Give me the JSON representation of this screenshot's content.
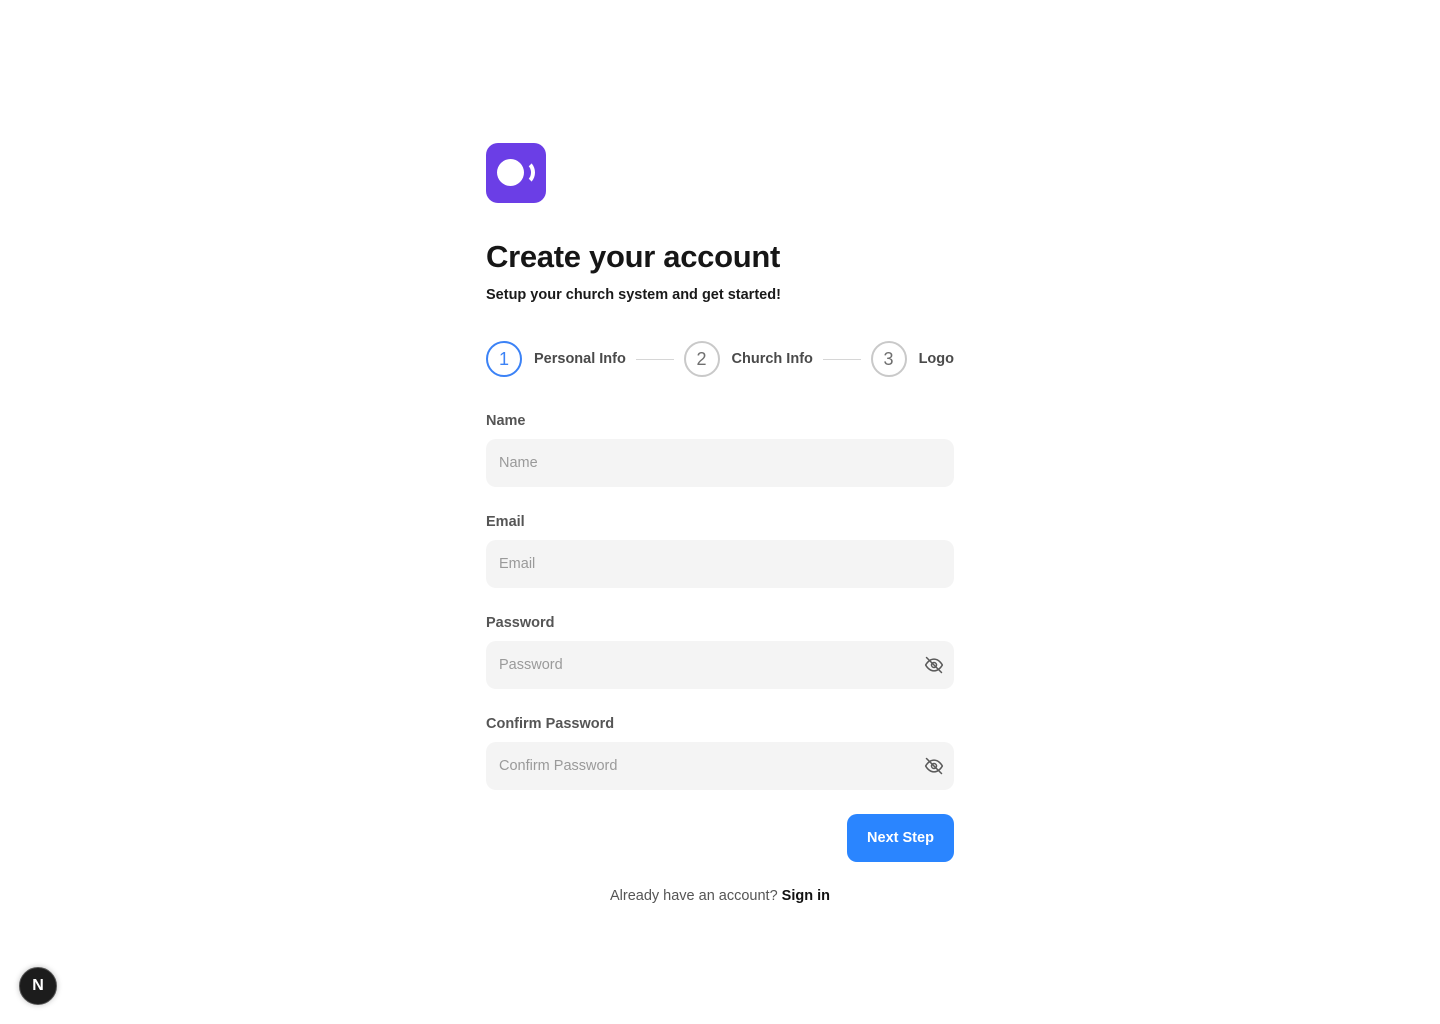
{
  "header": {
    "title": "Create your account",
    "subtitle": "Setup your church system and get started!"
  },
  "colors": {
    "brand": "#6b3ee6",
    "accent": "#2a85ff",
    "active_step": "#3b82f6"
  },
  "steps": [
    {
      "number": "1",
      "label": "Personal Info",
      "active": true
    },
    {
      "number": "2",
      "label": "Church Info",
      "active": false
    },
    {
      "number": "3",
      "label": "Logo",
      "active": false
    }
  ],
  "form": {
    "name": {
      "label": "Name",
      "placeholder": "Name",
      "value": ""
    },
    "email": {
      "label": "Email",
      "placeholder": "Email",
      "value": ""
    },
    "password": {
      "label": "Password",
      "placeholder": "Password",
      "value": "",
      "icon": "eye-off-icon"
    },
    "confirm_password": {
      "label": "Confirm Password",
      "placeholder": "Confirm Password",
      "value": "",
      "icon": "eye-off-icon"
    },
    "next_label": "Next Step"
  },
  "footer": {
    "prompt": "Already have an account?",
    "link": "Sign in"
  },
  "devtools": {
    "badge_label": "N"
  }
}
